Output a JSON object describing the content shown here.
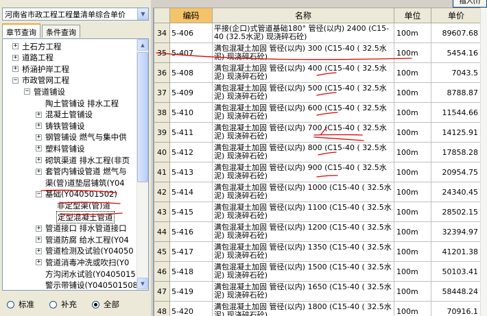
{
  "library": {
    "selected": "河南省市政工程工程量清单综合单价"
  },
  "tabs": [
    {
      "label": "章节查询"
    },
    {
      "label": "条件查询"
    }
  ],
  "tree": [
    {
      "label": "土石方工程",
      "level": 0,
      "exp": "+"
    },
    {
      "label": "道路工程",
      "level": 0,
      "exp": "+"
    },
    {
      "label": "桥涵护岸工程",
      "level": 0,
      "exp": "+"
    },
    {
      "label": "市政管网工程",
      "level": 0,
      "exp": "−"
    },
    {
      "label": "管道铺设",
      "level": 1,
      "exp": "−"
    },
    {
      "label": "陶土管铺设 排水工程",
      "level": 2,
      "exp": ""
    },
    {
      "label": "混凝土管铺设",
      "level": 2,
      "exp": "+"
    },
    {
      "label": "铸铁管铺设",
      "level": 2,
      "exp": "+"
    },
    {
      "label": "钢管铺设 燃气与集中供",
      "level": 2,
      "exp": "+"
    },
    {
      "label": "塑料管铺设",
      "level": 2,
      "exp": "+"
    },
    {
      "label": "砌筑渠道 排水工程(非页",
      "level": 2,
      "exp": "+"
    },
    {
      "label": "套管内铺设管道 燃气与",
      "level": 2,
      "exp": "+"
    },
    {
      "label": "渠(管)道垫层铺筑(Y04",
      "level": 2,
      "exp": ""
    },
    {
      "label": "基础(Y040501502)",
      "level": 2,
      "exp": "−"
    },
    {
      "label": "非定型渠(管)道",
      "level": 3,
      "exp": ""
    },
    {
      "label": "定型混凝土管道",
      "level": 3,
      "exp": "",
      "selected": true
    },
    {
      "label": "管道接口 排水管道接口",
      "level": 2,
      "exp": "+"
    },
    {
      "label": "管道防腐 给水工程(Y04",
      "level": 2,
      "exp": "+"
    },
    {
      "label": "管道检测及试验(Y04050",
      "level": 2,
      "exp": "+"
    },
    {
      "label": "管道消毒冲洗或吹扫(Y0",
      "level": 2,
      "exp": "+"
    },
    {
      "label": "方沟闭水试验(Y0405015",
      "level": 2,
      "exp": ""
    },
    {
      "label": "警示带铺设(Y040501508",
      "level": 2,
      "exp": ""
    }
  ],
  "filters": [
    {
      "label": "标准",
      "checked": false
    },
    {
      "label": "补充",
      "checked": false
    },
    {
      "label": "全部",
      "checked": true
    }
  ],
  "insert_button": "插入(I)",
  "table": {
    "headers": {
      "idx": "",
      "code": "编码",
      "name": "名称",
      "unit": "单位",
      "price": "单价"
    },
    "rows": [
      {
        "idx": "34",
        "code": "5-406",
        "name": "平接(企口)式管道基础180° 管径(以内) 2400 (C15-40 (32.5水泥) 现浇碎石砼)",
        "unit": "100m",
        "price": "89607.68"
      },
      {
        "idx": "35",
        "code": "5-407",
        "name": "满包混凝土加固 管径(以内) 300 (C15-40 ( 32.5水泥) 现浇碎石砼)",
        "unit": "100m",
        "price": "5454.16"
      },
      {
        "idx": "36",
        "code": "5-408",
        "name": "满包混凝土加固 管径(以内) 400 (C15-40 ( 32.5水泥) 现浇碎石砼)",
        "unit": "100m",
        "price": "7043.5"
      },
      {
        "idx": "37",
        "code": "5-409",
        "name": "满包混凝土加固 管径(以内) 500 (C15-40 ( 32.5水泥) 现浇碎石砼)",
        "unit": "100m",
        "price": "8788.87"
      },
      {
        "idx": "38",
        "code": "5-410",
        "name": "满包混凝土加固 管径(以内) 600 (C15-40 ( 32.5水泥) 现浇碎石砼)",
        "unit": "100m",
        "price": "11544.66"
      },
      {
        "idx": "39",
        "code": "5-411",
        "name": "满包混凝土加固 管径(以内) 700 (C15-40 ( 32.5水泥) 现浇碎石砼)",
        "unit": "100m",
        "price": "14125.91"
      },
      {
        "idx": "40",
        "code": "5-412",
        "name": "满包混凝土加固 管径(以内) 800 (C15-40 ( 32.5水泥) 现浇碎石砼)",
        "unit": "100m",
        "price": "17858.28"
      },
      {
        "idx": "41",
        "code": "5-413",
        "name": "满包混凝土加固 管径(以内) 900 (C15-40 ( 32.5水泥) 现浇碎石砼)",
        "unit": "100m",
        "price": "20954.75"
      },
      {
        "idx": "42",
        "code": "5-414",
        "name": "满包混凝土加固 管径(以内) 1000 (C15-40 ( 32.5水泥) 现浇碎石砼)",
        "unit": "100m",
        "price": "24340.45"
      },
      {
        "idx": "43",
        "code": "5-415",
        "name": "满包混凝土加固 管径(以内) 1100 (C15-40 ( 32.5水泥) 现浇碎石砼)",
        "unit": "100m",
        "price": "28502.15"
      },
      {
        "idx": "44",
        "code": "5-416",
        "name": "满包混凝土加固 管径(以内) 1200 (C15-40 ( 32.5水泥) 现浇碎石砼)",
        "unit": "100m",
        "price": "32394.97"
      },
      {
        "idx": "45",
        "code": "5-417",
        "name": "满包混凝土加固 管径(以内) 1350 (C15-40 ( 32.5水泥) 现浇碎石砼)",
        "unit": "100m",
        "price": "41201.38"
      },
      {
        "idx": "46",
        "code": "5-418",
        "name": "满包混凝土加固 管径(以内) 1500 (C15-40 ( 32.5水泥) 现浇碎石砼)",
        "unit": "100m",
        "price": "50103.41"
      },
      {
        "idx": "47",
        "code": "5-419",
        "name": "满包混凝土加固 管径(以内) 1650 (C15-40 ( 32.5水泥) 现浇碎石砼)",
        "unit": "100m",
        "price": "58448.24"
      },
      {
        "idx": "48",
        "code": "5-420",
        "name": "满包混凝土加固 管径(以内) 1800 (C15-40 ( 32.5水泥) 现浇碎石砼)",
        "unit": "100m",
        "price": "70916.1"
      }
    ]
  },
  "colors": {
    "header_active": "#f4c36a",
    "ink": "#e00000",
    "border": "#7f9db9"
  }
}
